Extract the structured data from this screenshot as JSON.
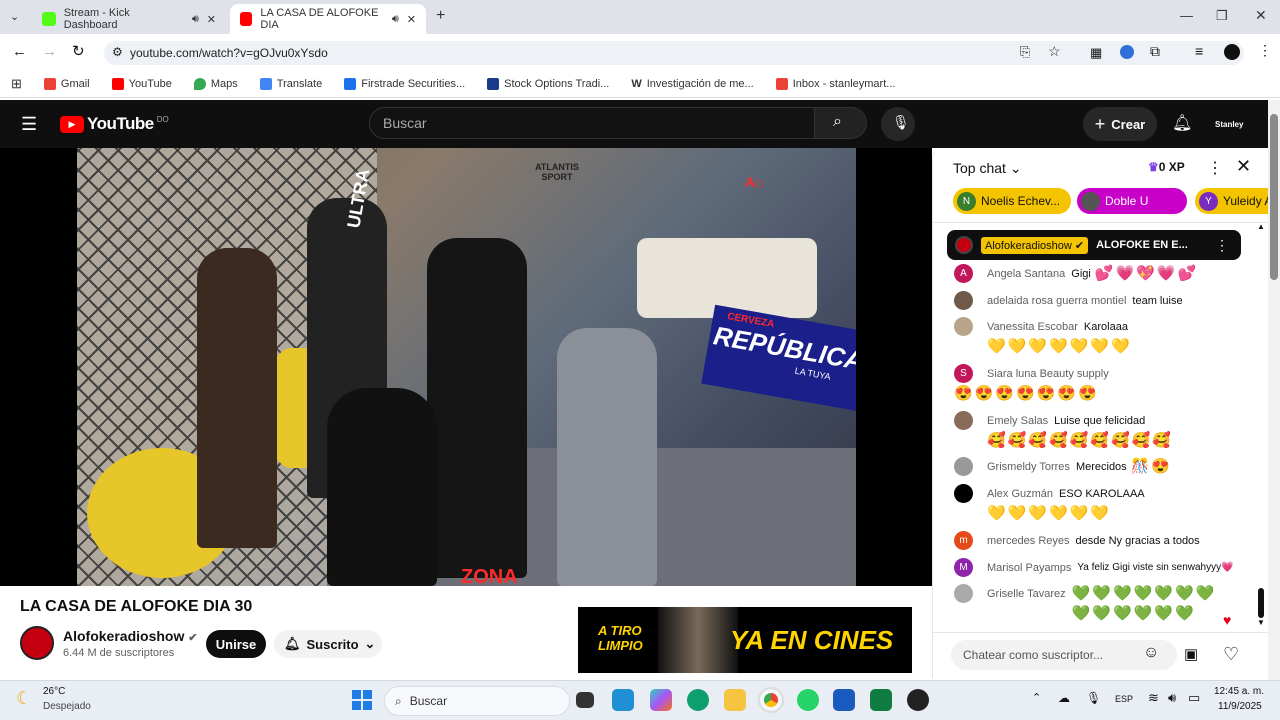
{
  "browser": {
    "tabs": [
      {
        "title": "Stream - Kick Dashboard",
        "active": false,
        "favicon_color": "#53fc18"
      },
      {
        "title": "LA CASA DE ALOFOKE DIA",
        "active": true,
        "favicon_color": "#ff0000"
      }
    ],
    "url": "youtube.com/watch?v=gOJvu0xYsdo",
    "bookmarks": [
      {
        "label": "Gmail",
        "icon": "gmail-icon"
      },
      {
        "label": "YouTube",
        "icon": "youtube-icon"
      },
      {
        "label": "Maps",
        "icon": "maps-icon"
      },
      {
        "label": "Translate",
        "icon": "translate-icon"
      },
      {
        "label": "Firstrade Securities...",
        "icon": "firstrade-icon"
      },
      {
        "label": "Stock Options Tradi...",
        "icon": "stock-icon"
      },
      {
        "label": "Investigación de me...",
        "icon": "w-icon"
      },
      {
        "label": "Inbox - stanleymart...",
        "icon": "gmail-icon"
      }
    ]
  },
  "youtube": {
    "logo_text": "YouTube",
    "logo_country": "DO",
    "search_placeholder": "Buscar",
    "create_label": "Crear",
    "user_label": "Stanley",
    "video_title": "LA CASA DE ALOFOKE DIA 30",
    "channel_name": "Alofokeradioshow",
    "subscribers": "6.44 M de suscriptores",
    "join_label": "Unirse",
    "subscribed_label": "Suscrito",
    "ad_text_left": "A TIRO LIMPIO",
    "ad_text_right": "YA EN CINES",
    "video_overlay": {
      "brand_left": "ATLANTIS SPORT",
      "banner": "REPÚBLICA",
      "banner_sub": "LA TUYA",
      "banner_top": "CERVEZA",
      "ultra": "ULTRA",
      "zona": "ZONA"
    }
  },
  "chat": {
    "mode": "Top chat",
    "xp": "0 XP",
    "pinned_chips": [
      {
        "initial": "N",
        "name": "Noelis Echev...",
        "bg": "#f4c400",
        "avatar": "#3a7d2c"
      },
      {
        "initial": "",
        "name": "Doble U",
        "bg": "#c800c8",
        "avatar": "#555"
      },
      {
        "initial": "Y",
        "name": "Yuleidy A",
        "bg": "#f4c400",
        "avatar": "#7b2cbf"
      }
    ],
    "pinned_message": {
      "author": "Alofokeradioshow",
      "text": "ALOFOKE EN E..."
    },
    "messages": [
      {
        "initial": "A",
        "avatar": "#c2185b",
        "author": "Angela Santana",
        "text": "Gigi",
        "emoji": "💕💗💖💗💕"
      },
      {
        "initial": "",
        "avatar": "#6d5a4a",
        "author": "adelaida rosa guerra montiel",
        "text": "team luise",
        "emoji": ""
      },
      {
        "initial": "",
        "avatar": "#b8a48a",
        "author": "Vanessita Escobar",
        "text": "Karolaaa",
        "emoji": "💛💛💛💛💛💛💛"
      },
      {
        "initial": "S",
        "avatar": "#c2185b",
        "author": "Siara luna Beauty supply",
        "text": "",
        "emoji": "😍😍😍😍😍😍😍"
      },
      {
        "initial": "",
        "avatar": "#8a6a5a",
        "author": "Emely Salas",
        "text": "Luise que felicidad",
        "emoji": "🥰🥰🥰🥰🥰🥰🥰🥰🥰"
      },
      {
        "initial": "",
        "avatar": "#999",
        "author": "Grismeldy Torres",
        "text": "Merecidos",
        "emoji": "🎊😍"
      },
      {
        "initial": "",
        "avatar": "#000",
        "author": "Alex Guzmán",
        "text": "ESO KAROLAAA",
        "emoji": "💛💛💛💛💛💛"
      },
      {
        "initial": "m",
        "avatar": "#e64a19",
        "author": "mercedes Reyes",
        "text": "desde Ny gracias a todos",
        "emoji": ""
      },
      {
        "initial": "M",
        "avatar": "#8e24aa",
        "author": "Marisol Payamps",
        "text": "Ya feliz Gigi viste sin senwahyyy",
        "emoji": "💗"
      },
      {
        "initial": "",
        "avatar": "#aaa",
        "author": "Griselle Tavarez",
        "text": "",
        "emoji": "💚💚💚💚💚💚💚💚💚💚💚💚💚"
      }
    ],
    "input_placeholder": "Chatear como suscriptor..."
  },
  "taskbar": {
    "temp": "26°C",
    "weather": "Despejado",
    "search": "Buscar",
    "lang": "ESP",
    "time": "12:45 a. m.",
    "date": "11/9/2025"
  }
}
